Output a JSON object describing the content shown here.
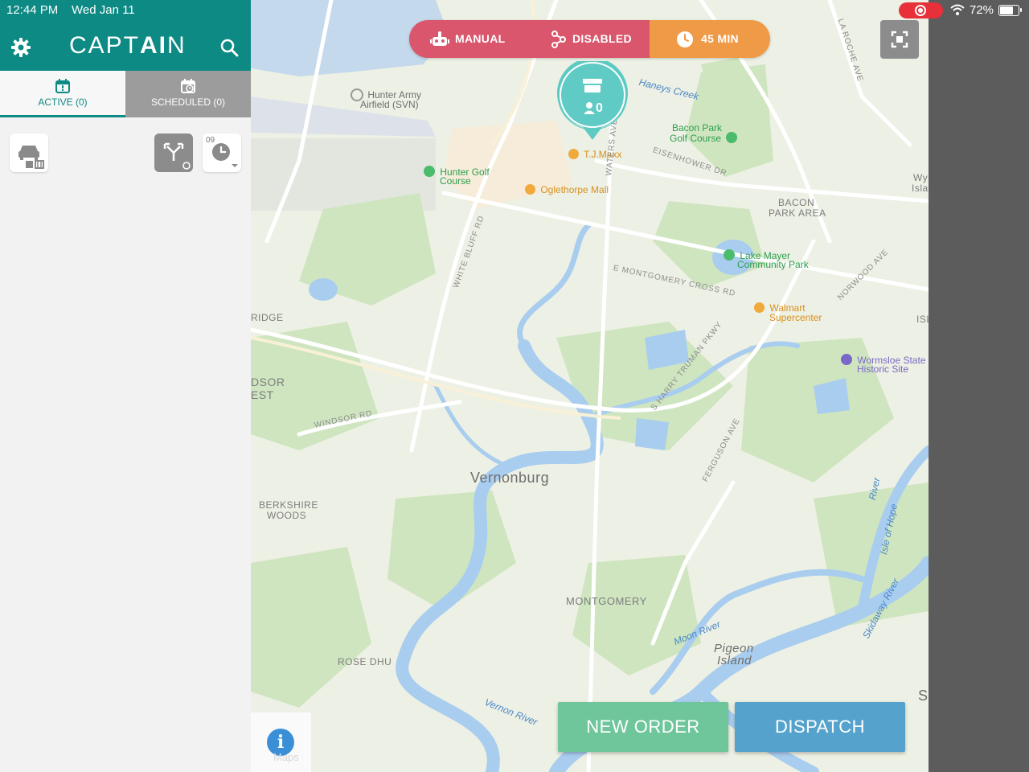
{
  "status_bar": {
    "time": "12:44 PM",
    "date": "Wed Jan 11",
    "battery": "72%"
  },
  "header": {
    "logo_text_1": "CAPT",
    "logo_text_2": "AI",
    "logo_text_3": "N"
  },
  "tabs": {
    "active": "ACTIVE (0)",
    "scheduled": "SCHEDULED (0)"
  },
  "tools": {
    "schedule_badge": "09"
  },
  "status_pill": {
    "manual": "MANUAL",
    "disabled": "DISABLED",
    "time": "45 MIN"
  },
  "store_marker": {
    "count": "0"
  },
  "map": {
    "labels": {
      "hunter_army": "Hunter Army",
      "airfield": "Airfield (SVN)",
      "haneys": "Haneys Creek",
      "bacon_park_1": "Bacon Park",
      "bacon_park_2": "Golf Course",
      "tjmaxx": "T.J.Maxx",
      "hunter_golf_1": "Hunter Golf",
      "hunter_golf_2": "Course",
      "oglethorpe": "Oglethorpe Mall",
      "waters": "WATERS AVE",
      "eisenhower": "EISENHOWER DR",
      "bacon_area_1": "BACON",
      "bacon_area_2": "PARK AREA",
      "white_bluff": "WHITE BLUFF RD",
      "montgomery_cross": "E MONTGOMERY CROSS RD",
      "lake_mayer_1": "Lake Mayer",
      "lake_mayer_2": "Community Park",
      "walmart_1": "Walmart",
      "walmart_2": "Supercenter",
      "norwood": "NORWOOD AVE",
      "ridge": "RIDGE",
      "wormsloe_1": "Wormsloe State",
      "wormsloe_2": "Historic Site",
      "truman": "S HARRY TRUMAN PKWY",
      "dsor": "DSOR",
      "est": "EST",
      "windsor": "WINDSOR RD",
      "vernonburg": "Vernonburg",
      "ferguson": "FERGUSON AVE",
      "river": "River",
      "isle_of_hope": "Isle of Hope",
      "berkshire_1": "BERKSHIRE",
      "berkshire_2": "WOODS",
      "montgomery": "MONTGOMERY",
      "skidaway": "Skidaway River",
      "moon": "Moon River",
      "pigeon_1": "Pigeon",
      "pigeon_2": "Island",
      "rose_dhu": "ROSE DHU",
      "vernon": "Vernon River",
      "la_roche": "LA ROCHE AVE",
      "isl": "ISL",
      "wy": "Wy",
      "isla": "Isla",
      "s_letter": "S",
      "maps_watermark": "Maps"
    }
  },
  "actions": {
    "new_order": "NEW ORDER",
    "dispatch": "DISPATCH"
  },
  "colors": {
    "brand_teal": "#0d8a84",
    "status_red": "#d9566c",
    "status_orange": "#ef9a46",
    "new_order_green": "#6ec69a",
    "dispatch_blue": "#55a3cc"
  }
}
